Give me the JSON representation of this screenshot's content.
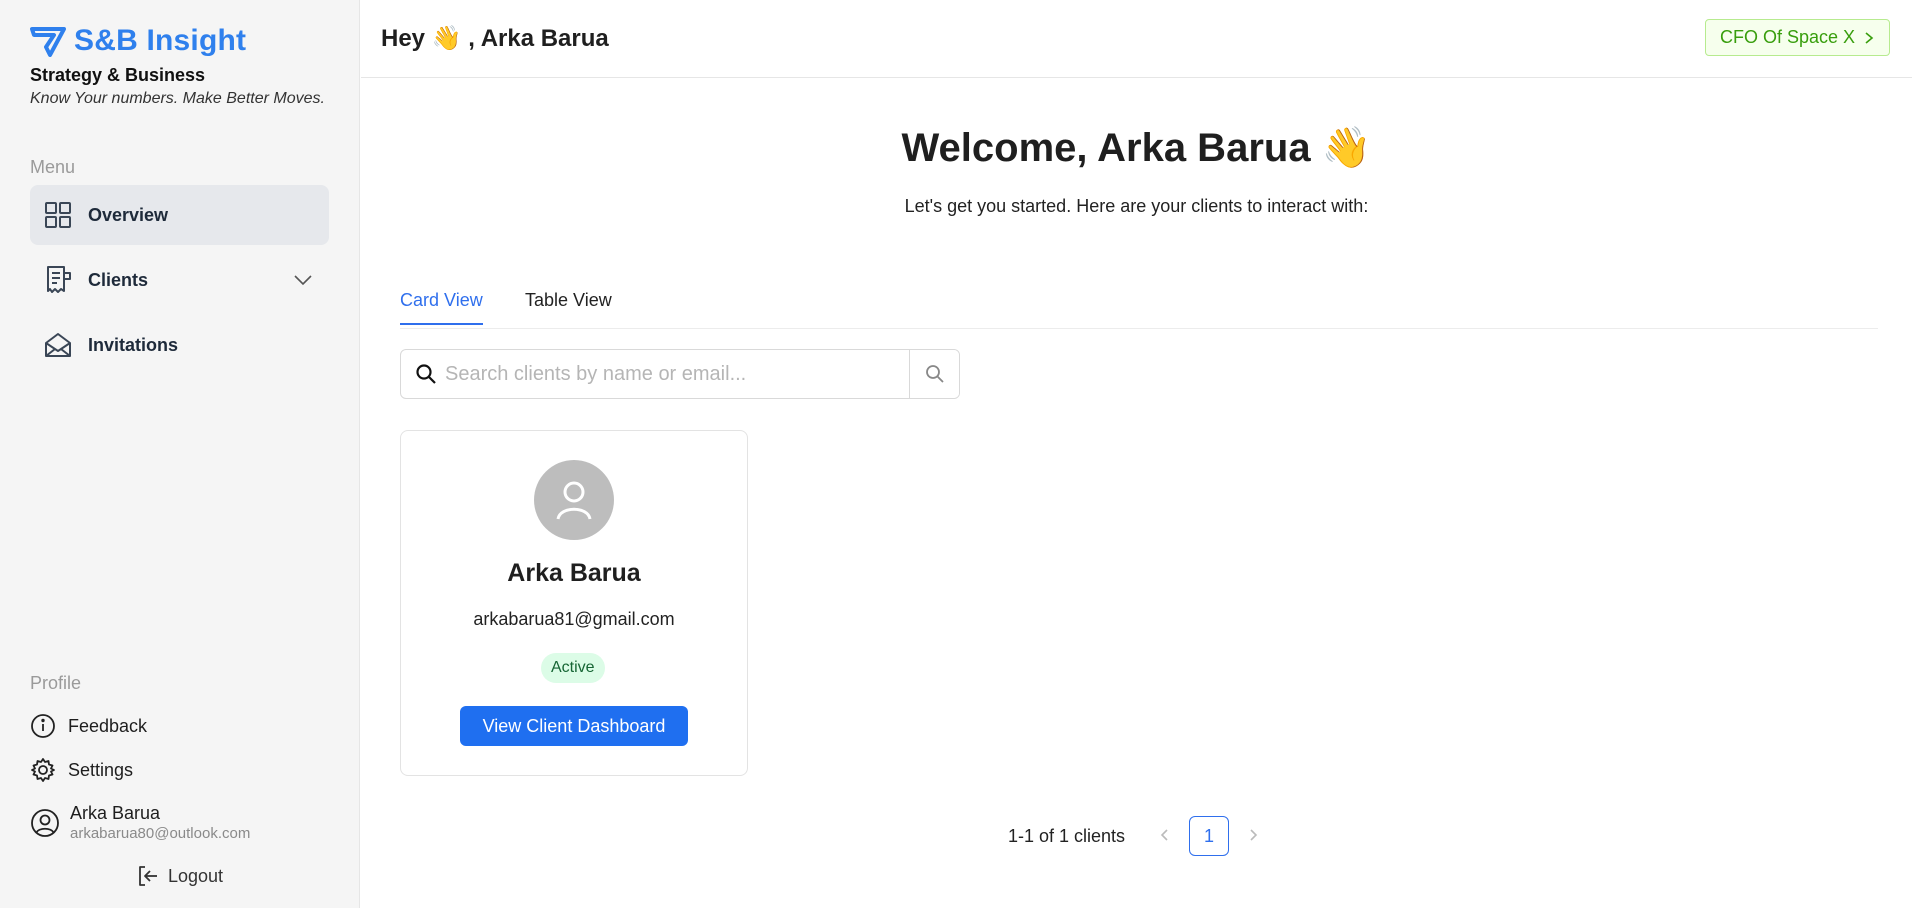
{
  "brand": {
    "name": "S&B Insight",
    "subtitle": "Strategy & Business",
    "tagline": "Know Your numbers. Make Better Moves.",
    "color": "#2f80ed"
  },
  "sidebar": {
    "menu_label": "Menu",
    "items": [
      {
        "label": "Overview",
        "icon": "dashboard-grid-icon",
        "active": true
      },
      {
        "label": "Clients",
        "icon": "receipt-icon",
        "expandable": true
      },
      {
        "label": "Invitations",
        "icon": "envelope-open-icon"
      }
    ],
    "profile_label": "Profile",
    "profile_items": [
      {
        "label": "Feedback",
        "icon": "info-icon"
      },
      {
        "label": "Settings",
        "icon": "gear-icon"
      }
    ],
    "user": {
      "name": "Arka Barua",
      "email": "arkabarua80@outlook.com"
    },
    "logout_label": "Logout"
  },
  "header": {
    "greeting": "Hey 👋 , Arka Barua",
    "org_button": "CFO Of Space X"
  },
  "main": {
    "welcome": "Welcome, Arka Barua 👋",
    "subtitle": "Let's get you started. Here are your clients to interact with:",
    "tabs": [
      {
        "label": "Card View",
        "active": true
      },
      {
        "label": "Table View",
        "active": false
      }
    ],
    "search": {
      "placeholder": "Search clients by name or email..."
    },
    "cards": [
      {
        "name": "Arka Barua",
        "email": "arkabarua81@gmail.com",
        "status": "Active",
        "button": "View Client Dashboard"
      }
    ],
    "pagination": {
      "summary": "1-1 of 1 clients",
      "current_page": "1"
    }
  }
}
